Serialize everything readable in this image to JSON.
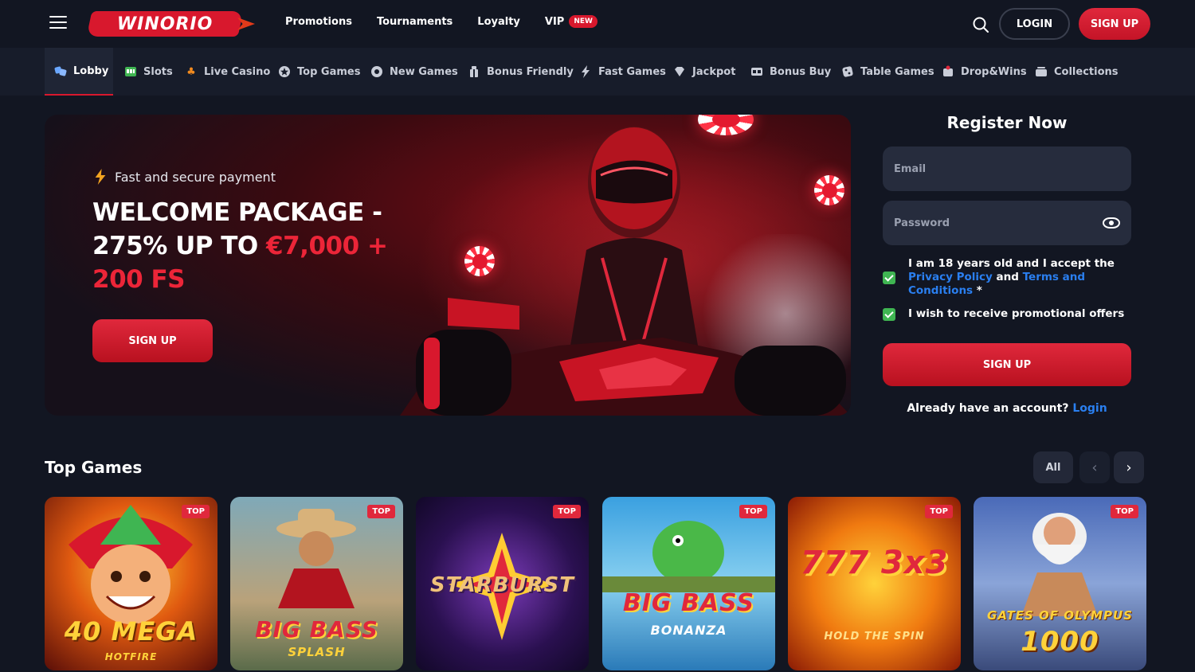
{
  "header": {
    "logo": "WINORIO",
    "nav": [
      {
        "label": "Promotions"
      },
      {
        "label": "Tournaments"
      },
      {
        "label": "Loyalty"
      },
      {
        "label": "VIP",
        "badge": "NEW"
      }
    ],
    "login_label": "LOGIN",
    "signup_label": "SIGN UP"
  },
  "categories": [
    {
      "label": "Lobby",
      "icon": "lobby-icon",
      "active": true
    },
    {
      "label": "Slots",
      "icon": "slots-icon"
    },
    {
      "label": "Live Casino",
      "icon": "club-icon"
    },
    {
      "label": "Top Games",
      "icon": "star-icon"
    },
    {
      "label": "New Games",
      "icon": "gem-icon"
    },
    {
      "label": "Bonus Friendly",
      "icon": "gift-icon"
    },
    {
      "label": "Fast Games",
      "icon": "bolt-icon"
    },
    {
      "label": "Jackpot",
      "icon": "diamond-icon"
    },
    {
      "label": "Bonus Buy",
      "icon": "cart-icon"
    },
    {
      "label": "Table Games",
      "icon": "dice-icon"
    },
    {
      "label": "Drop&Wins",
      "icon": "drop-icon"
    },
    {
      "label": "Collections",
      "icon": "collections-icon"
    }
  ],
  "hero": {
    "tagline": "Fast and secure payment",
    "title_white": "WELCOME PACKAGE - 275% UP TO ",
    "title_red": "€7,000 + 200 FS",
    "button_label": "SIGN UP"
  },
  "register": {
    "title": "Register Now",
    "email_placeholder": "Email",
    "password_placeholder": "Password",
    "terms_prefix": "I am 18 years old and I accept the ",
    "privacy_link": "Privacy Policy",
    "terms_and": " and ",
    "terms_link": "Terms and Conditions",
    "terms_suffix": " *",
    "promo_label": "I wish to receive promotional offers",
    "button_label": "SIGN UP",
    "already_text": "Already have an account?",
    "login_link": "Login"
  },
  "top_games": {
    "title": "Top Games",
    "all_label": "All",
    "badge": "TOP",
    "games": [
      {
        "name": "40 MEGA",
        "sub": "HOTFIRE"
      },
      {
        "name": "BIG BASS",
        "sub": "SPLASH"
      },
      {
        "name": "STARBURST",
        "sub": ""
      },
      {
        "name": "BIG BASS",
        "sub": "BONANZA"
      },
      {
        "name": "777 3x3",
        "sub": "HOLD THE SPIN"
      },
      {
        "name": "GATES OF OLYMPUS",
        "sub": "1000"
      }
    ]
  },
  "colors": {
    "accent": "#d8182d",
    "bg": "#121622",
    "link": "#2a7ff0",
    "check": "#3fb552"
  }
}
